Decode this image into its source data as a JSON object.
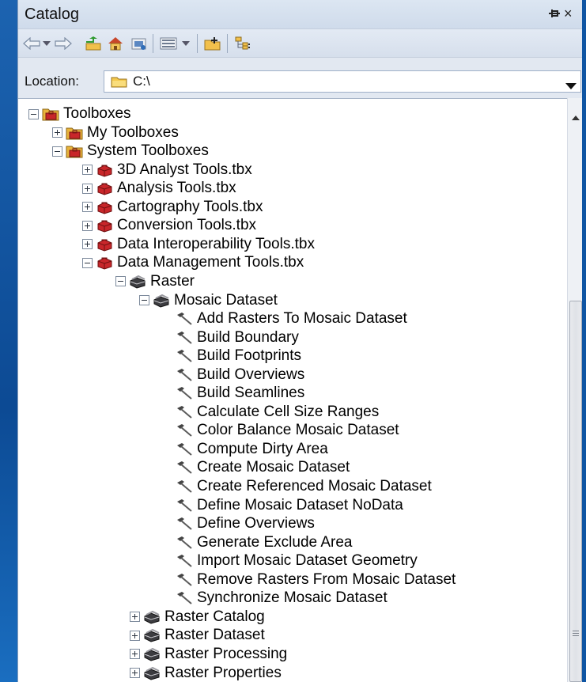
{
  "window": {
    "title": "Catalog",
    "pin_glyph": "❁",
    "close_glyph": "×"
  },
  "toolbar": {
    "buttons": [
      "back-icon",
      "back-dropdown-icon",
      "forward-icon",
      "up-folder-icon",
      "home-icon",
      "connect-folder-icon",
      "view-toggle-icon",
      "view-dropdown-icon",
      "new-folder-icon",
      "tree-view-icon"
    ]
  },
  "location": {
    "label": "Location:",
    "value": "C:\\"
  },
  "tree": {
    "items": [
      {
        "label": "Toolboxes",
        "expander": "minus",
        "icon": "toolboxes-folder-icon"
      },
      {
        "label": "My Toolboxes",
        "expander": "plus",
        "icon": "toolboxes-folder-icon"
      },
      {
        "label": "System Toolboxes",
        "expander": "minus",
        "icon": "toolboxes-folder-icon"
      },
      {
        "label": "3D Analyst Tools.tbx",
        "expander": "plus",
        "icon": "toolbox-icon"
      },
      {
        "label": "Analysis Tools.tbx",
        "expander": "plus",
        "icon": "toolbox-icon"
      },
      {
        "label": "Cartography Tools.tbx",
        "expander": "plus",
        "icon": "toolbox-icon"
      },
      {
        "label": "Conversion Tools.tbx",
        "expander": "plus",
        "icon": "toolbox-icon"
      },
      {
        "label": "Data Interoperability Tools.tbx",
        "expander": "plus",
        "icon": "toolbox-icon"
      },
      {
        "label": "Data Management Tools.tbx",
        "expander": "minus",
        "icon": "toolbox-icon"
      },
      {
        "label": "Raster",
        "expander": "minus",
        "icon": "toolset-icon"
      },
      {
        "label": "Mosaic Dataset",
        "expander": "minus",
        "icon": "toolset-icon"
      },
      {
        "label": "Add Rasters To Mosaic Dataset",
        "icon": "tool-hammer-icon"
      },
      {
        "label": "Build Boundary",
        "icon": "tool-hammer-icon"
      },
      {
        "label": "Build Footprints",
        "icon": "tool-hammer-icon"
      },
      {
        "label": "Build Overviews",
        "icon": "tool-hammer-icon"
      },
      {
        "label": "Build Seamlines",
        "icon": "tool-hammer-icon"
      },
      {
        "label": "Calculate Cell Size Ranges",
        "icon": "tool-hammer-icon"
      },
      {
        "label": "Color Balance Mosaic Dataset",
        "icon": "tool-hammer-icon"
      },
      {
        "label": "Compute Dirty Area",
        "icon": "tool-hammer-icon"
      },
      {
        "label": "Create Mosaic Dataset",
        "icon": "tool-hammer-icon"
      },
      {
        "label": "Create Referenced Mosaic Dataset",
        "icon": "tool-hammer-icon"
      },
      {
        "label": "Define Mosaic Dataset NoData",
        "icon": "tool-hammer-icon"
      },
      {
        "label": "Define Overviews",
        "icon": "tool-hammer-icon"
      },
      {
        "label": "Generate Exclude Area",
        "icon": "tool-hammer-icon"
      },
      {
        "label": "Import Mosaic Dataset Geometry",
        "icon": "tool-hammer-icon"
      },
      {
        "label": "Remove Rasters From Mosaic Dataset",
        "icon": "tool-hammer-icon"
      },
      {
        "label": "Synchronize Mosaic Dataset",
        "icon": "tool-hammer-icon"
      },
      {
        "label": "Raster Catalog",
        "expander": "plus",
        "icon": "toolset-icon"
      },
      {
        "label": "Raster Dataset",
        "expander": "plus",
        "icon": "toolset-icon"
      },
      {
        "label": "Raster Processing",
        "expander": "plus",
        "icon": "toolset-icon"
      },
      {
        "label": "Raster Properties",
        "expander": "plus",
        "icon": "toolset-icon"
      }
    ]
  },
  "colors": {
    "desktop": "#1565b8",
    "panel": "#d5dde9",
    "toolbox_red": "#c8262a"
  }
}
